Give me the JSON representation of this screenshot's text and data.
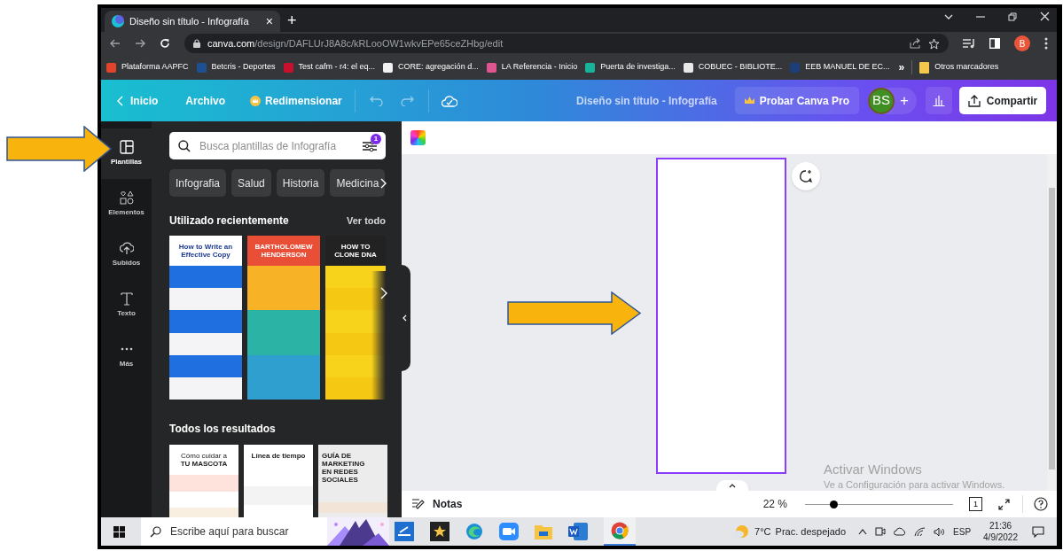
{
  "browser": {
    "tab_title": "Diseño sin título - Infografía",
    "tab_close": "×",
    "new_tab": "+",
    "url_host": "canva.com",
    "url_path": "/design/DAFLUrJ8A8c/kRLooOW1wkvEPe65ceZHbg/edit",
    "profile_initial": "B",
    "bookmarks": [
      {
        "label": "Plataforma AAPFC",
        "color": "#e0452c"
      },
      {
        "label": "Betcris - Deportes",
        "color": "#1d4f91"
      },
      {
        "label": "Test cafm - r4: el eq...",
        "color": "#c8102e"
      },
      {
        "label": "CORE: agregación d...",
        "color": "#f2f2f2"
      },
      {
        "label": "LA Referencia - Inicio",
        "color": "#e0558f"
      },
      {
        "label": "Puerta de investiga...",
        "color": "#17b39b"
      },
      {
        "label": "COBUEC - BIBLIOTE...",
        "color": "#e8e8e8"
      },
      {
        "label": "EEB MANUEL DE EC...",
        "color": "#1c3f7a"
      }
    ],
    "bookmarks_more": "»",
    "other_bookmarks": "Otros marcadores"
  },
  "header": {
    "back": "Inicio",
    "file": "Archivo",
    "resize": "Redimensionar",
    "title": "Diseño sin título - Infografía",
    "pro": "Probar Canva Pro",
    "avatar": "BS",
    "add": "+",
    "share": "Compartir"
  },
  "rail": [
    {
      "label": "Plantillas",
      "kind": "templates",
      "selected": true
    },
    {
      "label": "Elementos",
      "kind": "elements",
      "selected": false
    },
    {
      "label": "Subidos",
      "kind": "uploads",
      "selected": false
    },
    {
      "label": "Texto",
      "kind": "text",
      "selected": false
    },
    {
      "label": "Más",
      "kind": "more",
      "selected": false
    }
  ],
  "panel": {
    "search_placeholder": "Busca plantillas de Infografía",
    "filter_badge": "1",
    "chips": [
      "Infografia",
      "Salud",
      "Historia",
      "Medicina"
    ],
    "recent_heading": "Utilizado recientemente",
    "see_all": "Ver todo",
    "recent": [
      {
        "kind": "steps",
        "title": "How to Write an Effective Copy"
      },
      {
        "kind": "timeline",
        "title": "BARTHOLOMEW HENDERSON"
      },
      {
        "kind": "caution",
        "title": "HOW TO CLONE DNA"
      }
    ],
    "all_heading": "Todos los resultados",
    "all": [
      {
        "kind": "pet",
        "subtitle": "Cómo cuidar a",
        "title": "TU MASCOTA"
      },
      {
        "kind": "road",
        "title": "Línea de tiempo"
      },
      {
        "kind": "marketing",
        "title": "GUÍA DE MARKETING EN REDES SOCIALES"
      }
    ]
  },
  "canvas": {
    "notes": "Notas",
    "zoom": "22 %",
    "zoom_slider": {
      "level": 0.19
    },
    "page_number": "1"
  },
  "activation": {
    "title": "Activar Windows",
    "subtitle": "Ve a Configuración para activar Windows."
  },
  "taskbar": {
    "search_placeholder": "Escribe aquí para buscar",
    "temperature": "7°C",
    "weather": "Prac. despejado",
    "language": "ESP",
    "time": "21:36",
    "date": "4/9/2022"
  }
}
